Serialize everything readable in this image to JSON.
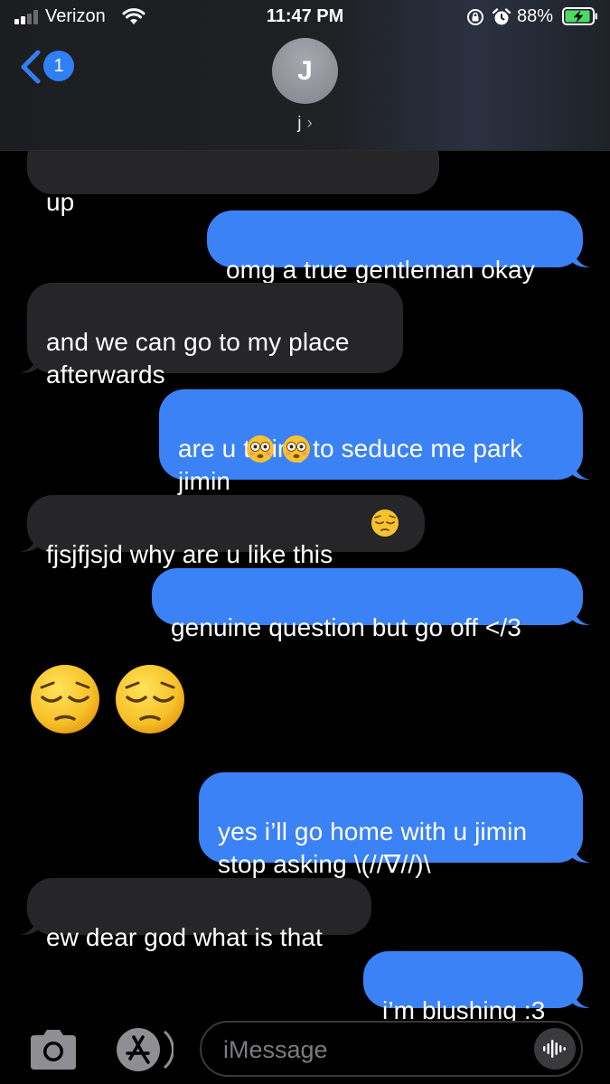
{
  "status_bar": {
    "carrier": "Verizon",
    "time": "11:47 PM",
    "battery_percent": "88%"
  },
  "header": {
    "unread_count": "1",
    "avatar_initial": "J",
    "contact_name": "j",
    "contact_chevron": "›"
  },
  "messages": [
    {
      "side": "received",
      "text": "up"
    },
    {
      "side": "sent",
      "text": "omg a true gentleman okay"
    },
    {
      "side": "received",
      "text": "and we can go to my place\nafterwards"
    },
    {
      "side": "sent",
      "text": "are u trying to seduce me park\njimin"
    },
    {
      "side": "received",
      "text": "fjsjfjsjd why are u like this"
    },
    {
      "side": "sent",
      "text": "genuine question but go off </3"
    },
    {
      "side": "received",
      "type": "emoji-only",
      "emoji": [
        "pensive-face",
        "pensive-face"
      ]
    },
    {
      "side": "sent",
      "text": "yes i’ll go home with u jimin\nstop asking \\(//∇//)\\"
    },
    {
      "side": "received",
      "text": "ew dear god what is that"
    },
    {
      "side": "sent",
      "text": "i’m blushing :3"
    }
  ],
  "inline_emoji": {
    "message_4": [
      "flushed-face",
      "flushed-face"
    ],
    "message_5": [
      "pensive-face"
    ]
  },
  "compose": {
    "placeholder": "iMessage"
  },
  "icons": {
    "signal": "cellular-signal-icon",
    "wifi": "wifi-icon",
    "lock": "orientation-lock-icon",
    "alarm": "alarm-icon",
    "battery": "battery-charging-icon",
    "back": "chevron-left-icon",
    "camera": "camera-icon",
    "appstore": "app-store-icon",
    "audio": "audio-waveform-icon"
  },
  "colors": {
    "sent_bubble": "#3b82f6",
    "received_bubble": "#262628",
    "accent": "#2f7ff5",
    "battery_fill": "#4cd964"
  }
}
